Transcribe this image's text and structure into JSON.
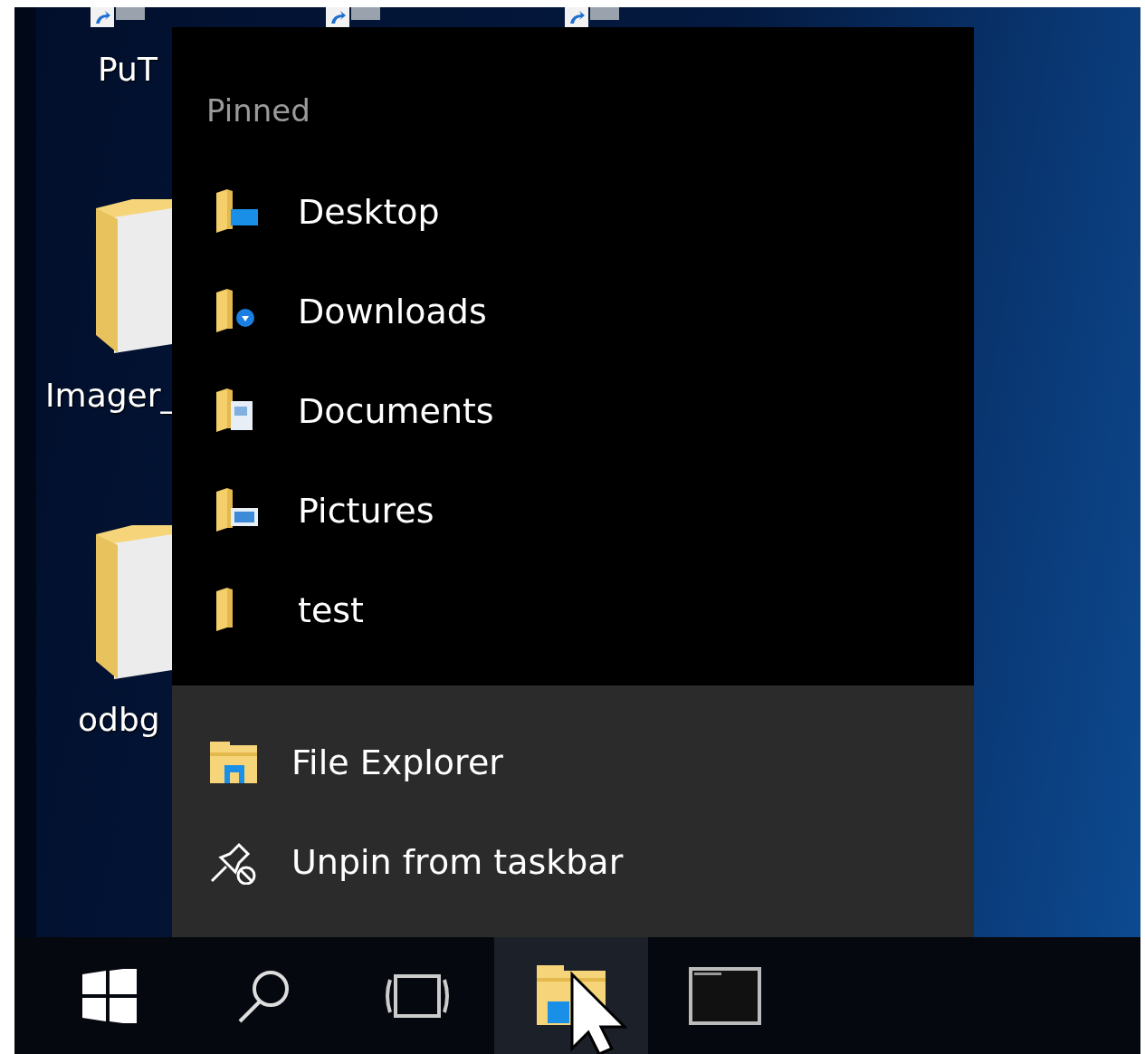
{
  "desktop": {
    "icons": [
      {
        "label": "PuT"
      },
      {
        "label": "Imager_"
      },
      {
        "label": "odbg"
      }
    ]
  },
  "jump_list": {
    "section_title": "Pinned",
    "pinned": [
      {
        "label": "Desktop",
        "kind": "desktop"
      },
      {
        "label": "Downloads",
        "kind": "downloads"
      },
      {
        "label": "Documents",
        "kind": "documents"
      },
      {
        "label": "Pictures",
        "kind": "pictures"
      },
      {
        "label": "test",
        "kind": "folder"
      }
    ],
    "tasks": [
      {
        "label": "File Explorer",
        "kind": "explorer"
      },
      {
        "label": "Unpin from taskbar",
        "kind": "unpin"
      }
    ]
  },
  "taskbar": {
    "buttons": [
      {
        "kind": "start",
        "selected": false
      },
      {
        "kind": "search",
        "selected": false
      },
      {
        "kind": "taskview",
        "selected": false
      },
      {
        "kind": "explorer",
        "selected": true
      },
      {
        "kind": "terminal",
        "selected": false
      }
    ]
  }
}
